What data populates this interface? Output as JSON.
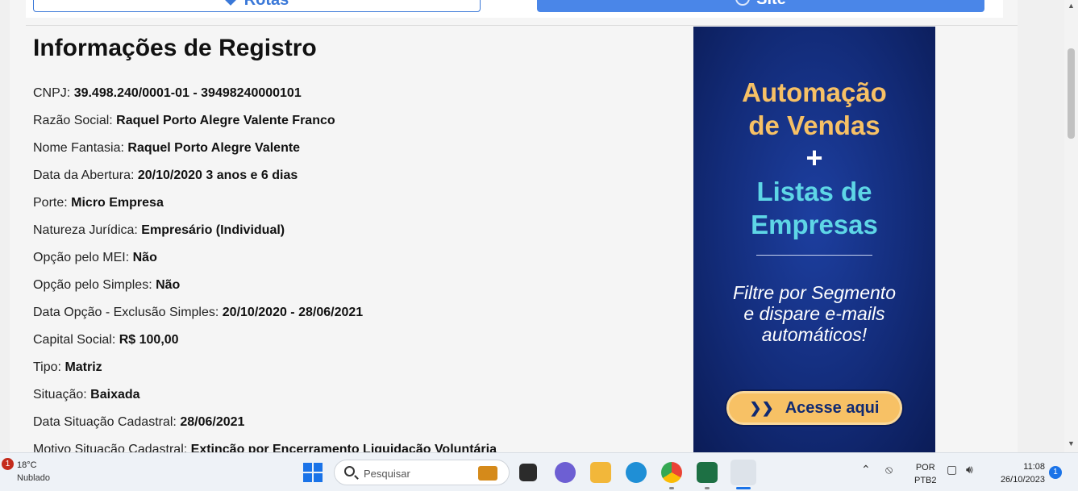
{
  "top_buttons": {
    "rotas_label": "Rotas",
    "site_label": "Site"
  },
  "registro": {
    "title": "Informações de Registro",
    "rows": [
      {
        "label": "CNPJ:",
        "value": "39.498.240/0001-01 - 39498240000101"
      },
      {
        "label": "Razão Social:",
        "value": "Raquel Porto Alegre Valente Franco"
      },
      {
        "label": "Nome Fantasia:",
        "value": "Raquel Porto Alegre Valente"
      },
      {
        "label": "Data da Abertura:",
        "value": "20/10/2020 3 anos e 6 dias"
      },
      {
        "label": "Porte:",
        "value": "Micro Empresa"
      },
      {
        "label": "Natureza Jurídica:",
        "value": "Empresário (Individual)"
      },
      {
        "label": "Opção pelo MEI:",
        "value": "Não"
      },
      {
        "label": "Opção pelo Simples:",
        "value": "Não"
      },
      {
        "label": "Data Opção - Exclusão Simples:",
        "value": "20/10/2020 - 28/06/2021"
      },
      {
        "label": "Capital Social:",
        "value": "R$ 100,00"
      },
      {
        "label": "Tipo:",
        "value": "Matriz"
      },
      {
        "label": "Situação:",
        "value": "Baixada"
      },
      {
        "label": "Data Situação Cadastral:",
        "value": "28/06/2021"
      },
      {
        "label": "Motivo Situação Cadastral:",
        "value": "Extinção por Encerramento Liquidação Voluntária"
      }
    ]
  },
  "ad": {
    "line1": "Automação",
    "line2": "de Vendas",
    "plus": "+",
    "line3": "Listas de",
    "line4": "Empresas",
    "sub1": "Filtre por Segmento",
    "sub2": "e dispare e-mails",
    "sub3": "automáticos!",
    "cta": "Acesse aqui"
  },
  "taskbar": {
    "weather_badge": "1",
    "temperature": "18°C",
    "weather": "Nublado",
    "search_placeholder": "Pesquisar",
    "lang_1": "POR",
    "lang_2": "PTB2",
    "time": "11:08",
    "date": "26/10/2023",
    "notifications": "1"
  },
  "colors": {
    "accent": "#4a86e8",
    "ad_bg": "#132c7a",
    "ad_gold": "#f7c165",
    "ad_cyan": "#5ed6e6"
  }
}
